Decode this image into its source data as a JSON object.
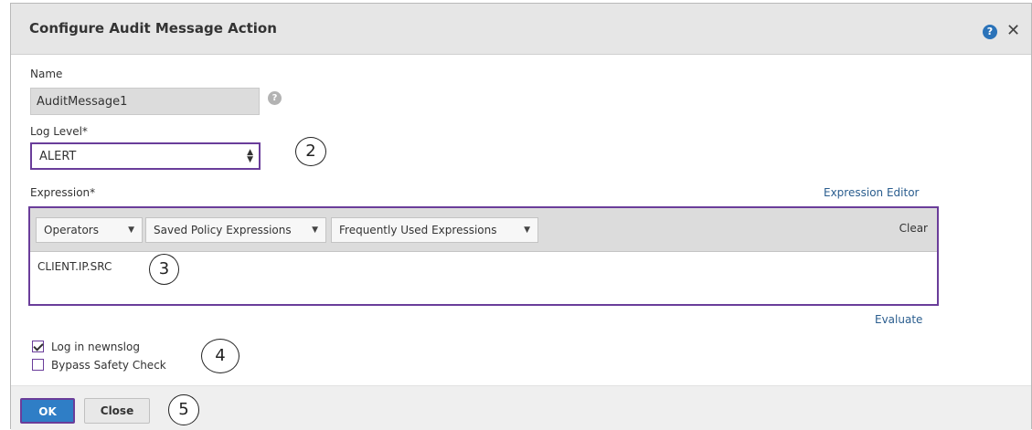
{
  "dialog": {
    "title": "Configure Audit Message Action",
    "help_icon_glyph": "?",
    "close_icon_glyph": "✕"
  },
  "form": {
    "name_label": "Name",
    "name_value": "AuditMessage1",
    "name_help_glyph": "?",
    "log_level_label": "Log Level*",
    "log_level_value": "ALERT",
    "expression_label": "Expression*",
    "expression_editor_link": "Expression Editor",
    "toolbar": {
      "operators": "Operators",
      "saved_policy": "Saved Policy Expressions",
      "frequently_used": "Frequently Used Expressions",
      "clear": "Clear"
    },
    "expression_value": "CLIENT.IP.SRC",
    "evaluate_link": "Evaluate",
    "log_in_newnslog": {
      "label": "Log in newnslog",
      "checked": true
    },
    "bypass_safety_check": {
      "label": "Bypass Safety Check",
      "checked": false
    }
  },
  "footer": {
    "ok_label": "OK",
    "close_label": "Close"
  },
  "callouts": [
    "2",
    "3",
    "4",
    "5"
  ],
  "colors": {
    "accent_border": "#6a3d9a",
    "primary_button": "#2f7ec6",
    "link": "#2a5d8e",
    "titlebar": "#e6e6e6"
  }
}
